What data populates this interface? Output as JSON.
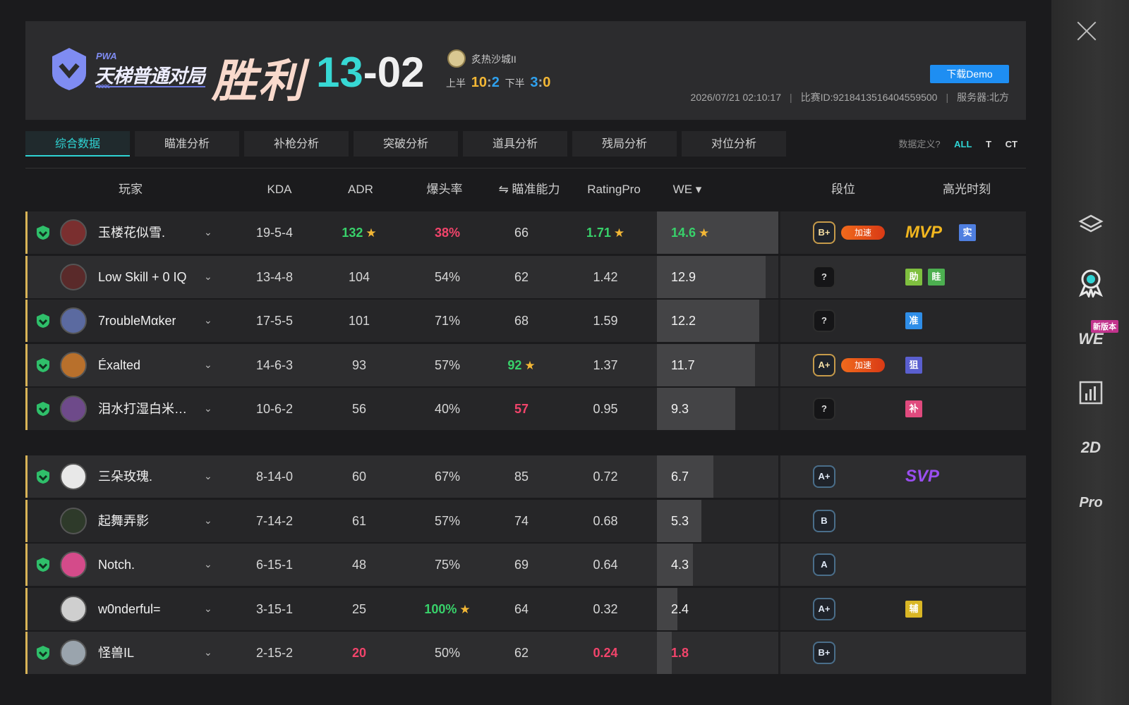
{
  "header": {
    "mode_sub": "PWA",
    "mode_title": "天梯普通对局",
    "mode_arrows": "<<<<",
    "result": "胜利",
    "score_left": "13",
    "score_dash": "-",
    "score_right": "02",
    "map_name": "炙热沙城II",
    "first_half_label": "上半",
    "first_half_t": "10",
    "first_half_sep": ":",
    "first_half_ct": "2",
    "second_half_label": "下半",
    "second_half_t": "3",
    "second_half_sep": ":",
    "second_half_ct": "0",
    "demo_button": "下载Demo",
    "datetime": "2026/07/21 02:10:17",
    "match_id": "比赛ID:9218413516404559500",
    "server": "服务器:北方",
    "meta_sep": "|"
  },
  "tabs": [
    "综合数据",
    "瞄准分析",
    "补枪分析",
    "突破分析",
    "道具分析",
    "残局分析",
    "对位分析"
  ],
  "filters": {
    "label": "数据定义?",
    "all": "ALL",
    "t": "T",
    "ct": "CT"
  },
  "columns": {
    "player": "玩家",
    "kda": "KDA",
    "adr": "ADR",
    "hs": "爆头率",
    "aim": "⇋ 瞄准能力",
    "rating": "RatingPro",
    "we": "WE ▾",
    "rank": "段位",
    "highlight": "高光时刻"
  },
  "rail": {
    "we_label": "WE",
    "we_badge": "新版本",
    "two_d": "2D",
    "pro": "Pro"
  },
  "rank_boost": "加速",
  "highlights": {
    "mvp": "MVP",
    "svp": "SVP"
  },
  "team1": [
    {
      "name": "玉楼花似雪.",
      "kda": "19-5-4",
      "adr": "132",
      "hs": "38%",
      "aim": "66",
      "rating": "1.71",
      "we": "14.6",
      "we_frac": 1.0,
      "rank": "B+",
      "boost": true,
      "highlight": "MVP",
      "tags": [
        {
          "t": "实",
          "c": "#4f7fe0"
        }
      ],
      "shield": true
    },
    {
      "name": "Low Skill + 0 IQ",
      "kda": "13-4-8",
      "adr": "104",
      "hs": "54%",
      "aim": "62",
      "rating": "1.42",
      "we": "12.9",
      "we_frac": 0.884,
      "rank": "?",
      "boost": false,
      "highlight": "",
      "tags": [
        {
          "t": "助",
          "c": "#7fbf3f"
        },
        {
          "t": "眭",
          "c": "#4caf50"
        }
      ],
      "shield": false
    },
    {
      "name": "7roubleMαker",
      "kda": "17-5-5",
      "adr": "101",
      "hs": "71%",
      "aim": "68",
      "rating": "1.59",
      "we": "12.2",
      "we_frac": 0.836,
      "rank": "?",
      "boost": false,
      "highlight": "",
      "tags": [
        {
          "t": "准",
          "c": "#2f8ee8"
        }
      ],
      "shield": true
    },
    {
      "name": "Éxalted",
      "kda": "14-6-3",
      "adr": "93",
      "hs": "57%",
      "aim": "92",
      "rating": "1.37",
      "we": "11.7",
      "we_frac": 0.801,
      "rank": "A+",
      "boost": true,
      "highlight": "",
      "tags": [
        {
          "t": "狙",
          "c": "#5a5fcf"
        }
      ],
      "shield": true
    },
    {
      "name": "泪水打湿白米饭...",
      "kda": "10-6-2",
      "adr": "56",
      "hs": "40%",
      "aim": "57",
      "rating": "0.95",
      "we": "9.3",
      "we_frac": 0.637,
      "rank": "?",
      "boost": false,
      "highlight": "",
      "tags": [
        {
          "t": "补",
          "c": "#e04a7e"
        }
      ],
      "shield": true
    }
  ],
  "team2": [
    {
      "name": "三朵玫瑰.",
      "kda": "8-14-0",
      "adr": "60",
      "hs": "67%",
      "aim": "85",
      "rating": "0.72",
      "we": "6.7",
      "we_frac": 0.459,
      "rank": "A+",
      "highlight": "SVP",
      "tags": [],
      "shield": true
    },
    {
      "name": "起舞弄影",
      "kda": "7-14-2",
      "adr": "61",
      "hs": "57%",
      "aim": "74",
      "rating": "0.68",
      "we": "5.3",
      "we_frac": 0.363,
      "rank": "B",
      "highlight": "",
      "tags": [],
      "shield": false
    },
    {
      "name": "Notch.",
      "kda": "6-15-1",
      "adr": "48",
      "hs": "75%",
      "aim": "69",
      "rating": "0.64",
      "we": "4.3",
      "we_frac": 0.295,
      "rank": "A",
      "highlight": "",
      "tags": [],
      "shield": true
    },
    {
      "name": "w0nderful=",
      "kda": "3-15-1",
      "adr": "25",
      "hs": "100%",
      "aim": "64",
      "rating": "0.32",
      "we": "2.4",
      "we_frac": 0.164,
      "rank": "A+",
      "highlight": "",
      "tags": [
        {
          "t": "辅",
          "c": "#d9b625"
        }
      ],
      "shield": false
    },
    {
      "name": "怪兽IL",
      "kda": "2-15-2",
      "adr": "20",
      "hs": "50%",
      "aim": "62",
      "rating": "0.24",
      "we": "1.8",
      "we_frac": 0.123,
      "rank": "B+",
      "highlight": "",
      "tags": [],
      "shield": true
    }
  ],
  "colors": {
    "accent": "#2fd4d4",
    "good": "#38d16a",
    "bad": "#f2446b",
    "gold": "#f3b735",
    "row_edge": "#d9b457"
  }
}
